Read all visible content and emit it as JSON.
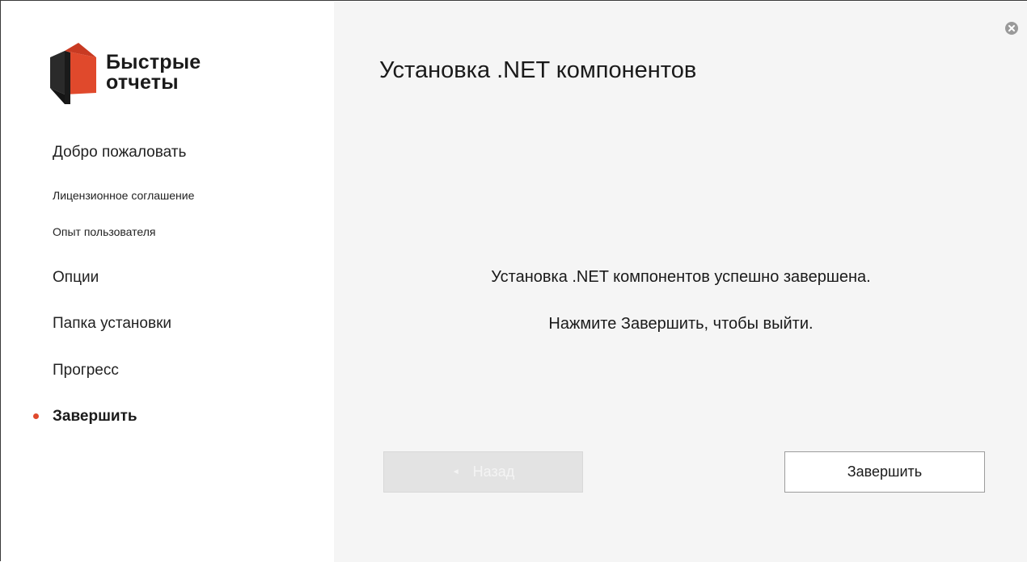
{
  "app": {
    "logo_line1": "Быстрые",
    "logo_line2": "отчеты",
    "brand_color": "#e0492c"
  },
  "sidebar": {
    "items": [
      {
        "label": "Добро пожаловать",
        "state": "normal"
      },
      {
        "label": "Лицензионное соглашение",
        "state": "normal"
      },
      {
        "label": "Опыт пользователя",
        "state": "normal"
      },
      {
        "label": "Опции",
        "state": "normal"
      },
      {
        "label": "Папка установки",
        "state": "normal"
      },
      {
        "label": "Прогресс",
        "state": "normal"
      },
      {
        "label": "Завершить",
        "state": "active"
      }
    ]
  },
  "main": {
    "title": "Установка .NET компонентов",
    "message_line1": "Установка .NET компонентов успешно завершена.",
    "message_line2": "Нажмите Завершить, чтобы выйти."
  },
  "buttons": {
    "back_label": "Назад",
    "back_icon": "chevron-left-icon",
    "back_enabled": false,
    "finish_label": "Завершить"
  },
  "window": {
    "close_icon": "close-circle-icon"
  }
}
